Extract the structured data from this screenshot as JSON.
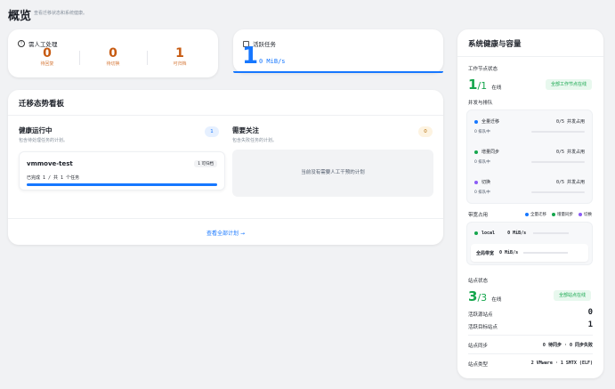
{
  "page": {
    "title": "概览",
    "subtitle": "查看迁移状态和系统健康。"
  },
  "manual": {
    "title": "需人工处理",
    "stats": [
      {
        "value": "0",
        "label": "待回复"
      },
      {
        "value": "0",
        "label": "待切换"
      },
      {
        "value": "1",
        "label": "可归档"
      }
    ]
  },
  "active": {
    "title": "活跃任务",
    "count": "1",
    "speed": "0 MiB/s"
  },
  "board": {
    "title": "迁移态势看板",
    "healthy": {
      "title": "健康运行中",
      "desc": "包含待处理任务的计划。",
      "count": "1"
    },
    "attention": {
      "title": "需要关注",
      "desc": "包含失败任务的计划。",
      "count": "0"
    },
    "plan": {
      "name": "vmmove-test",
      "badge": "1 可归档",
      "progress_text": "已完成 1 / 共 1 个任务",
      "progress": 1.0
    },
    "empty_text": "当前没有需要人工干预的计划",
    "view_all": "查看全部计划 →"
  },
  "health": {
    "title": "系统健康与容量",
    "workers": {
      "label": "工作节点状态",
      "current": "1",
      "total": "/1",
      "suffix": "在线",
      "badge": "全部工作节点在线"
    },
    "queue": {
      "label": "并发与排队",
      "rows": [
        {
          "name": "全量迁移",
          "cap": "0/5 并发占用",
          "waiting": "0 排队中",
          "color": "#1677ff"
        },
        {
          "name": "增量同步",
          "cap": "0/5 并发占用",
          "waiting": "0 排队中",
          "color": "#15a64d"
        },
        {
          "name": "切换",
          "cap": "0/5 并发占用",
          "waiting": "0 排队中",
          "color": "#8b5cf6"
        }
      ]
    },
    "bandwidth": {
      "label": "带宽占用",
      "legend": [
        "全量迁移",
        "增量同步",
        "切换"
      ],
      "local_name": "local",
      "local_value": "0 MiB/s",
      "total_name": "全局带宽",
      "total_value": "0 MiB/s"
    },
    "sites": {
      "label": "站点状态",
      "current": "3",
      "total": "/3",
      "suffix": "在线",
      "badge": "全部站点在线",
      "source_label": "活跃源站点",
      "source_value": "0",
      "target_label": "活跃目标站点",
      "target_value": "1",
      "sync_label": "站点同步",
      "sync_value": "0 待同步 · 0 同步失败",
      "type_label": "站点类型",
      "type_value": "2 VMware · 1 SMTX (ELF)"
    }
  }
}
